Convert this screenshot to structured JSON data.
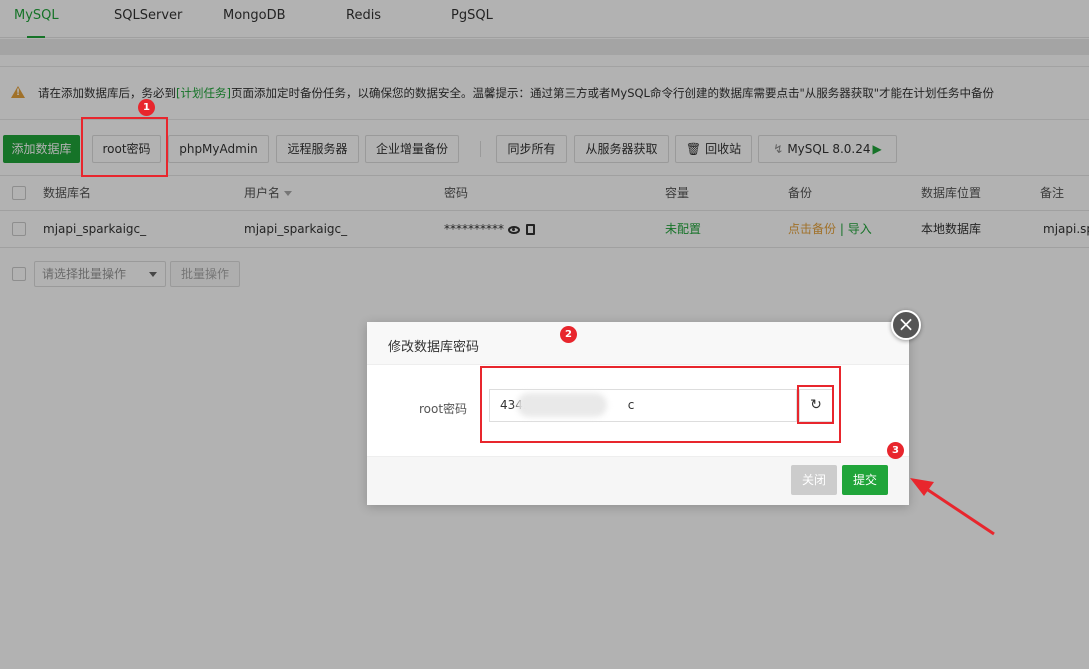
{
  "tabs": [
    {
      "label": "MySQL",
      "active": true
    },
    {
      "label": "SQLServer",
      "active": false
    },
    {
      "label": "MongoDB",
      "active": false
    },
    {
      "label": "Redis",
      "active": false
    },
    {
      "label": "PgSQL",
      "active": false
    }
  ],
  "notice": {
    "text_a": "请在添加数据库后，务必到",
    "link": "[计划任务]",
    "text_b": "页面添加定时备份任务，以确保您的数据安全。温馨提示：通过第三方或者MySQL命令行创建的数据库需要点击\"从服务器获取\"才能在计划任务中备份"
  },
  "toolbar": {
    "add_db": "添加数据库",
    "root_pwd": "root密码",
    "phpmyadmin": "phpMyAdmin",
    "remote": "远程服务器",
    "backup": "企业增量备份",
    "sync": "同步所有",
    "fetch": "从服务器获取",
    "recycle": "回收站",
    "mysql_version": "MySQL 8.0.24"
  },
  "table": {
    "columns": [
      "数据库名",
      "用户名",
      "密码",
      "容量",
      "备份",
      "数据库位置",
      "备注"
    ],
    "rows": [
      {
        "db_name": "mjapi_sparkaigc_",
        "user": "mjapi_sparkaigc_",
        "password": "**********",
        "capacity": "未配置",
        "backup_link": "点击备份",
        "backup_sep": "|",
        "import": "导入",
        "location": "本地数据库",
        "remark": "mjapi.sp"
      }
    ]
  },
  "batch": {
    "select_placeholder": "请选择批量操作",
    "button": "批量操作"
  },
  "modal": {
    "title": "修改数据库密码",
    "label": "root密码",
    "value_start": "434.",
    "value_end": "c",
    "close": "关闭",
    "submit": "提交"
  },
  "annotations": [
    "1",
    "2",
    "3"
  ],
  "colors": {
    "accent": "#20a53a",
    "annotation": "#e8262d",
    "warning": "#e6a23c"
  }
}
